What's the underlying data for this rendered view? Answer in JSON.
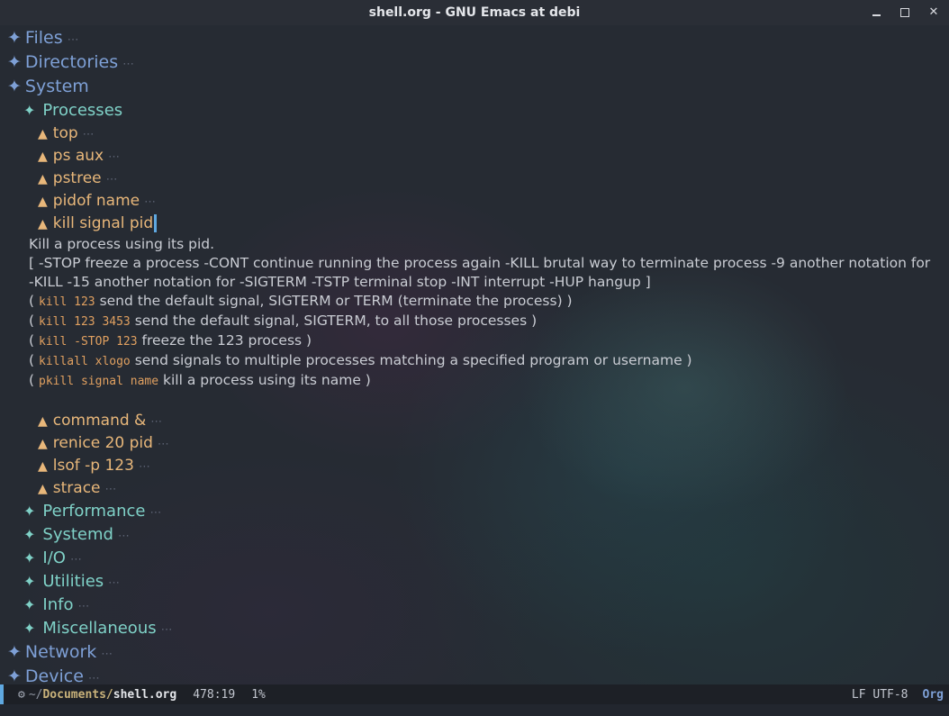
{
  "window": {
    "title": "shell.org - GNU Emacs at debi"
  },
  "outline": {
    "files": "Files",
    "directories": "Directories",
    "system": "System",
    "processes": "Processes",
    "top": "top",
    "ps_aux": "ps aux",
    "pstree": "pstree",
    "pidof": "pidof name",
    "kill": "kill signal pid",
    "command_bg": "command &",
    "renice": "renice 20 pid",
    "lsof": "lsof -p 123",
    "strace": "strace",
    "performance": "Performance",
    "systemd": "Systemd",
    "io": "I/O",
    "utilities": "Utilities",
    "info": "Info",
    "misc": "Miscellaneous",
    "network": "Network",
    "device": "Device"
  },
  "kill_body": {
    "intro": "Kill a process using its pid.",
    "signals_line1": "[ -STOP freeze a process -CONT continue running the process again -KILL brutal way to terminate process -9 another notation for",
    "signals_line2": "-KILL -15 another notation for -SIGTERM -TSTP terminal stop -INT interrupt -HUP hangup ]",
    "ex1_code": "kill 123",
    "ex1_text": "send the default signal, SIGTERM or TERM (terminate the process) )",
    "ex2_code": "kill 123 3453",
    "ex2_text": "send the default signal, SIGTERM, to all those processes )",
    "ex3_code": "kill -STOP 123",
    "ex3_text": "freeze the 123 process )",
    "ex4_code": "killall xlogo",
    "ex4_text": "send signals to multiple processes matching a specified program or username )",
    "ex5_code": "pkill signal name",
    "ex5_text": "kill a process using its name )",
    "open_paren": "("
  },
  "symbols": {
    "h1_bullet": "✦",
    "h2_bullet": "✦",
    "h3_bullet": "▲",
    "fold": "⋯"
  },
  "modeline": {
    "dir": "~/",
    "dir_bold": "Documents/",
    "file": "shell.org",
    "position": "478:19",
    "percent": "1%",
    "encoding": "LF UTF-8",
    "mode": "Org"
  },
  "colors": {
    "h1": "#7ea0d6",
    "h2": "#7fd1c7",
    "h3": "#e8b77a",
    "code": "#e0a060",
    "cursor": "#5fa8e0"
  }
}
